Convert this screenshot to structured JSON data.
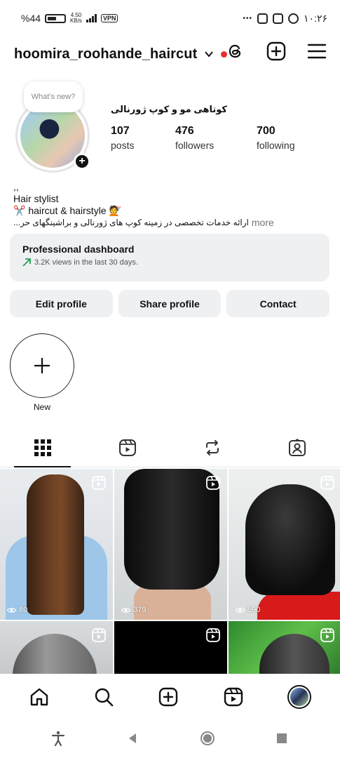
{
  "status_bar": {
    "battery": "%44",
    "speed_top": "4.50",
    "speed_bottom": "KB/s",
    "vpn": "VPN",
    "more": "•••",
    "time": "۱۰:۲۶"
  },
  "header": {
    "username": "hoomira_roohande_haircut",
    "icons": [
      "chevron-down-icon",
      "threads-icon",
      "create-post-icon",
      "menu-icon"
    ]
  },
  "profile": {
    "note_placeholder": "What's new?",
    "full_name": "کوتاهی مو و کوپ ژورنالی",
    "stats": [
      {
        "value": "107",
        "label": "posts"
      },
      {
        "value": "476",
        "label": "followers"
      },
      {
        "value": "700",
        "label": "following"
      }
    ]
  },
  "bio": {
    "line0": ",,",
    "line1": "Hair stylist",
    "line2": "✂️ haircut & hairstyle 💇",
    "line3": "ارائه خدمات تخصصی در زمینه کوپ های ژورنالی و براشینگهای حر...",
    "more": "more"
  },
  "dashboard": {
    "title": "Professional dashboard",
    "subtitle": "3.2K views in the last 30 days."
  },
  "buttons": {
    "edit": "Edit profile",
    "share": "Share profile",
    "contact": "Contact"
  },
  "highlight": {
    "new_label": "New"
  },
  "tabs": [
    "grid-icon",
    "reels-icon",
    "reposts-icon",
    "tagged-icon"
  ],
  "grid": [
    {
      "views": "80",
      "reel": true
    },
    {
      "views": "379",
      "reel": true
    },
    {
      "views": "590",
      "reel": true
    },
    {
      "views": "",
      "reel": true
    },
    {
      "views": "",
      "reel": true
    },
    {
      "views": "",
      "reel": true
    }
  ],
  "bottom_nav": [
    "home-icon",
    "search-icon",
    "create-icon",
    "reels-icon",
    "profile-avatar"
  ],
  "colors": {
    "accent_red": "#e5312f",
    "card_bg": "#eff0f2",
    "trend_green": "#1f9d55"
  }
}
